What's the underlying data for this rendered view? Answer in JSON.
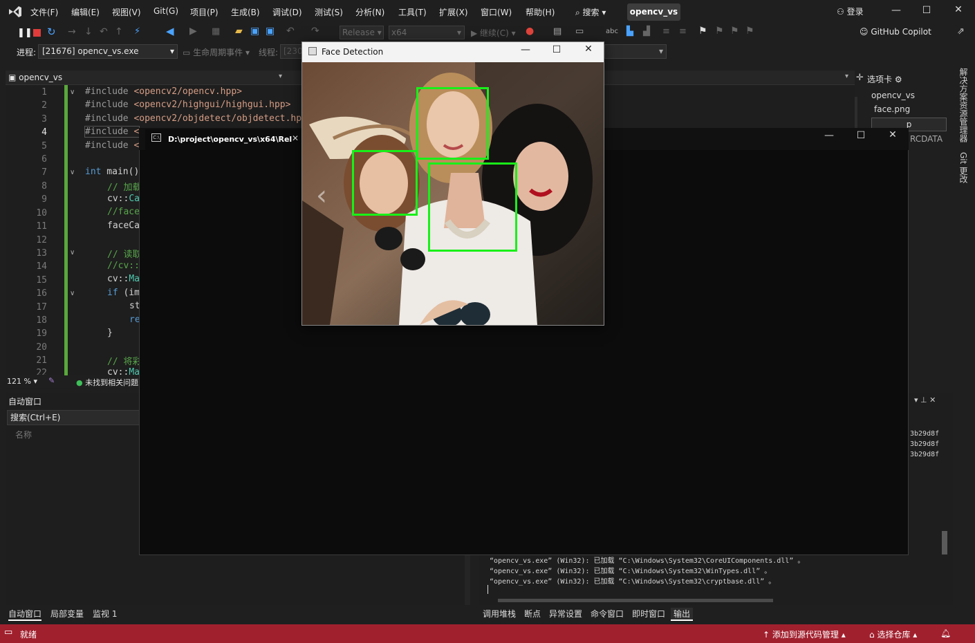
{
  "menu": [
    "文件(F)",
    "编辑(E)",
    "视图(V)",
    "Git(G)",
    "项目(P)",
    "生成(B)",
    "调试(D)",
    "测试(S)",
    "分析(N)",
    "工具(T)",
    "扩展(X)",
    "窗口(W)",
    "帮助(H)"
  ],
  "search_label": "搜索",
  "solution_title": "opencv_vs",
  "login": "登录",
  "toolbar": {
    "config": "Release",
    "platform": "x64",
    "continue": "继续(C)",
    "copilot": "GitHub Copilot"
  },
  "process": {
    "label": "进程:",
    "value": "[21676] opencv_vs.exe",
    "lifecycle": "生命周期事件",
    "thread_label": "线程:",
    "thread_value": "[230"
  },
  "editor": {
    "nav_project": "opencv_vs",
    "line_numbers": [
      "1",
      "2",
      "3",
      "4",
      "5",
      "6",
      "7",
      "8",
      "9",
      "10",
      "11",
      "12",
      "13",
      "14",
      "15",
      "16",
      "17",
      "18",
      "19",
      "20",
      "21",
      "22"
    ],
    "zoom": "121 %",
    "issues": "未找到相关问题"
  },
  "solution_explorer": {
    "tab": "选项卡",
    "items": [
      "opencv_vs",
      "face.png",
      "p",
      "RCDATA"
    ]
  },
  "side_tabs": [
    "解决方案资源管理器",
    "Git 更改"
  ],
  "autos": {
    "title": "自动窗口",
    "search": "搜索(Ctrl+E)",
    "name_col": "名称"
  },
  "bottom_tabs_left": [
    "自动窗口",
    "局部变量",
    "监视 1"
  ],
  "bottom_tabs_right": [
    "调用堆栈",
    "断点",
    "异常设置",
    "命令窗口",
    "即时窗口",
    "输出"
  ],
  "output": {
    "lines": [
      "“opencv_vs.exe” (Win32): 已加载 “C:\\Windows\\System32\\CoreUIComponents.dll” 。",
      "“opencv_vs.exe” (Win32): 已加载 “C:\\Windows\\System32\\WinTypes.dll” 。",
      "“opencv_vs.exe” (Win32): 已加载 “C:\\Windows\\System32\\cryptbase.dll” 。"
    ],
    "right_fragments": [
      "3b29d8f",
      "3b29d8f",
      "3b29d8f"
    ]
  },
  "status": {
    "ready": "就绪",
    "add_source": "添加到源代码管理",
    "repo": "选择仓库"
  },
  "console": {
    "title": "D:\\project\\opencv_vs\\x64\\Rel"
  },
  "face_window": {
    "title": "Face Detection"
  },
  "colors": {
    "status_bar": "#a1202e",
    "detect_box": "#19f019",
    "change_bar": "#5aa83c"
  }
}
